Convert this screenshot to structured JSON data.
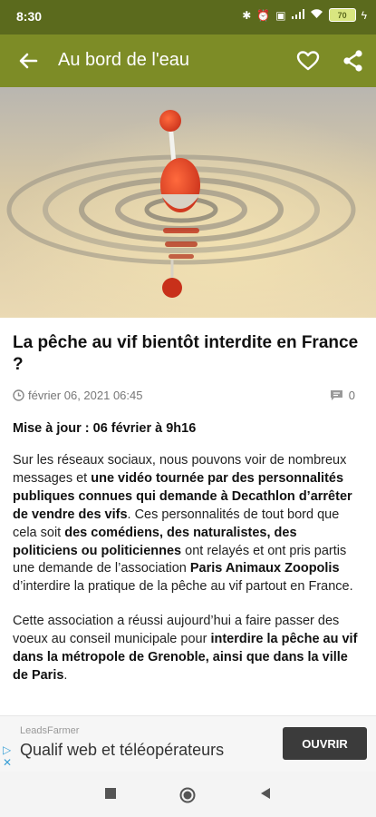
{
  "status": {
    "time": "8:30",
    "battery": "70"
  },
  "toolbar": {
    "title": "Au bord de l'eau",
    "back_icon": "arrow-left-icon",
    "favorite_icon": "heart-icon",
    "share_icon": "share-icon"
  },
  "article": {
    "headline": "La pêche au vif bientôt interdite en France ?",
    "date": "février 06, 2021 06:45",
    "comment_count": "0",
    "update": "Mise à jour : 06 février à 9h16",
    "p1": [
      {
        "t": "Sur les réseaux sociaux, nous pouvons voir de nombreux messages et ",
        "b": false
      },
      {
        "t": "une vidéo tournée par des personnalités publiques connues qui demande à Decathlon d’arrêter de vendre des vifs",
        "b": true
      },
      {
        "t": ". Ces personnalités de tout bord que cela soit ",
        "b": false
      },
      {
        "t": "des comédiens, des naturalistes, des politiciens ou politiciennes",
        "b": true
      },
      {
        "t": " ont relayés et ont pris partis une demande de l’association ",
        "b": false
      },
      {
        "t": "Paris Animaux Zoopolis",
        "b": true
      },
      {
        "t": " d’interdire la pratique de la pêche au vif partout en France.",
        "b": false
      }
    ],
    "p2": [
      {
        "t": "Cette association a réussi aujourd’hui a faire passer des voeux au conseil municipale pour ",
        "b": false
      },
      {
        "t": "interdire la pêche au vif dans la métropole de Grenoble, ainsi que dans la ville de Paris",
        "b": true
      },
      {
        "t": ".",
        "b": false
      }
    ]
  },
  "ad": {
    "advertiser": "LeadsFarmer",
    "text": "Qualif web et téléopérateurs",
    "button": "OUVRIR"
  },
  "navbar": {
    "items": [
      "square-icon",
      "circle-home-icon",
      "triangle-back-icon"
    ]
  }
}
